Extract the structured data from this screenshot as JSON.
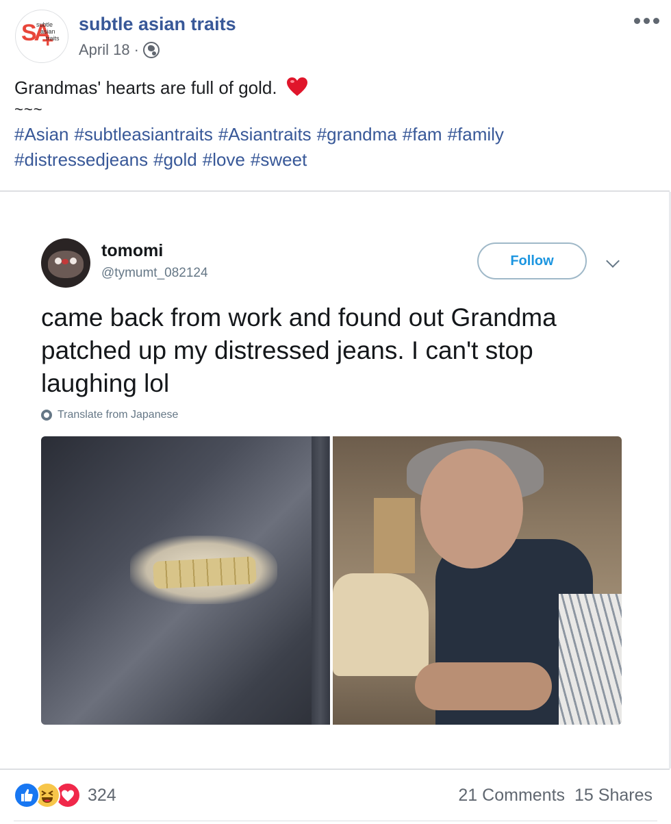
{
  "post": {
    "page_name": "subtle asian traits",
    "avatar_text": {
      "main": "SA",
      "plus": "+",
      "line1": "subtle",
      "line2": "asian",
      "line3": "traits"
    },
    "date": "April 18",
    "separator": "·",
    "privacy_icon": "globe-icon",
    "menu_icon": "more-icon",
    "message": "Grandmas' hearts are full of gold.",
    "message_emoji": "heart-icon",
    "tilde_line": "~~~",
    "hashtags_line1": [
      "#Asian",
      "#subtleasiantraits",
      "#Asiantraits",
      "#grandma",
      "#fam",
      "#family"
    ],
    "hashtags_line2": [
      "#distressedjeans",
      "#gold",
      "#love",
      "#sweet"
    ]
  },
  "tweet": {
    "name": "tomomi",
    "handle": "@tymumt_082124",
    "follow_label": "Follow",
    "text": "came back from work and found out Grandma patched up my distressed jeans. I can't stop laughing lol",
    "translate_label": "Translate from Japanese"
  },
  "footer": {
    "reaction_icons": [
      "like-icon",
      "haha-icon",
      "love-icon"
    ],
    "reaction_count": "324",
    "comments": "21 Comments",
    "shares": "15 Shares"
  },
  "colors": {
    "link": "#385898",
    "meta": "#616770",
    "twitter_blue": "#1b95e0",
    "like_blue": "#1877f2",
    "love_red": "#f0284a",
    "haha_yellow": "#f7c64a"
  }
}
